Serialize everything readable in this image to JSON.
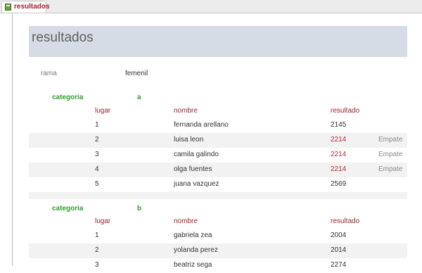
{
  "tab": {
    "label": "resultados",
    "icon": "report-icon"
  },
  "report": {
    "title": "resultados",
    "rama_label": "rama",
    "rama_value": "femenil",
    "groups": [
      {
        "categoria_label": "categoria",
        "categoria_value": "a",
        "headers": {
          "lugar": "lugar",
          "nombre": "nombre",
          "resultado": "resultado"
        },
        "rows": [
          {
            "lugar": "1",
            "nombre": "fernanda arellano",
            "resultado": "2145",
            "nota": ""
          },
          {
            "lugar": "2",
            "nombre": "luisa leon",
            "resultado": "2214",
            "nota": "Empate"
          },
          {
            "lugar": "3",
            "nombre": "camila galindo",
            "resultado": "2214",
            "nota": "Empate"
          },
          {
            "lugar": "4",
            "nombre": "olga fuentes",
            "resultado": "2214",
            "nota": "Empate"
          },
          {
            "lugar": "5",
            "nombre": "juana vazquez",
            "resultado": "2569",
            "nota": ""
          }
        ]
      },
      {
        "categoria_label": "categoria",
        "categoria_value": "b",
        "headers": {
          "lugar": "lugar",
          "nombre": "nombre",
          "resultado": "resultado"
        },
        "rows": [
          {
            "lugar": "1",
            "nombre": "gabriela zea",
            "resultado": "2004",
            "nota": ""
          },
          {
            "lugar": "2",
            "nombre": "yolanda perez",
            "resultado": "2014",
            "nota": ""
          },
          {
            "lugar": "3",
            "nombre": "beatriz sega",
            "resultado": "2274",
            "nota": ""
          }
        ]
      }
    ]
  },
  "colors": {
    "header_band": "#d6dce5",
    "category_green": "#2e9f2e",
    "column_head_red": "#9c2328",
    "tie_red": "#c0272d",
    "alt_row": "#f2f2f2"
  }
}
